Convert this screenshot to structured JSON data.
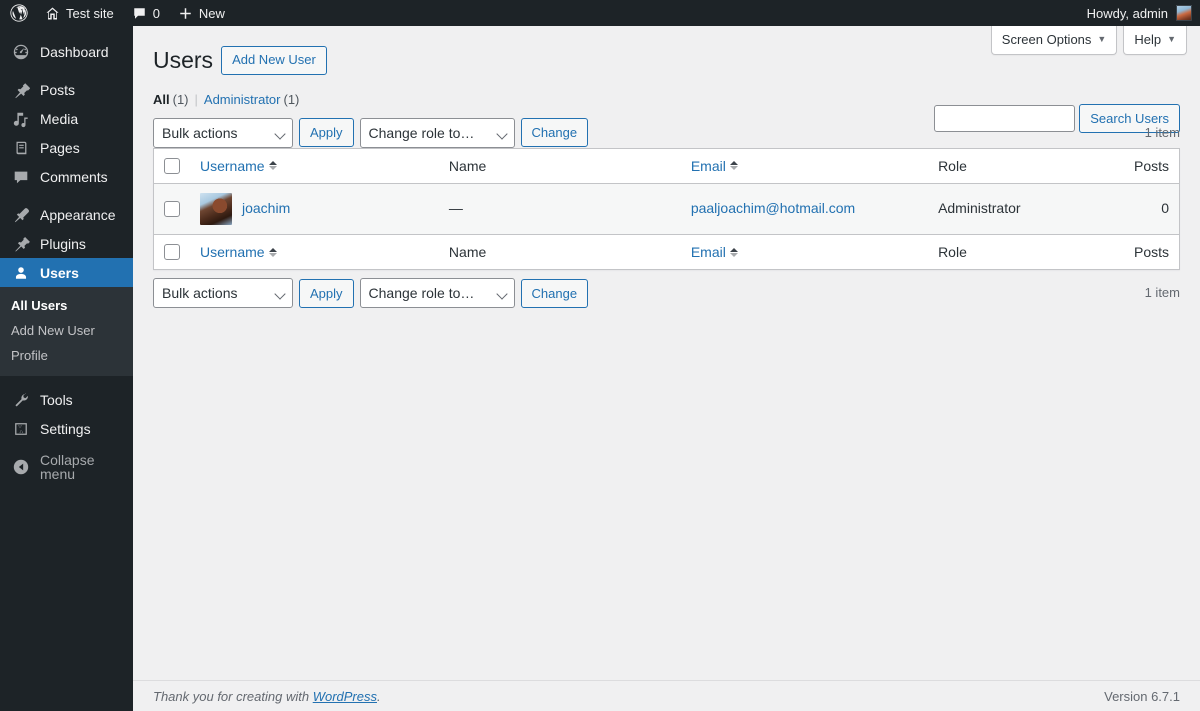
{
  "adminbar": {
    "site_name": "Test site",
    "comments_count": "0",
    "new_label": "New",
    "howdy": "Howdy, admin"
  },
  "sidebar": {
    "items": [
      {
        "label": "Dashboard",
        "icon": "dashboard-icon",
        "current": false
      },
      {
        "label": "Posts",
        "icon": "posts-pin-icon",
        "current": false
      },
      {
        "label": "Media",
        "icon": "media-icon",
        "current": false
      },
      {
        "label": "Pages",
        "icon": "pages-icon",
        "current": false
      },
      {
        "label": "Comments",
        "icon": "comments-icon",
        "current": false
      },
      {
        "label": "Appearance",
        "icon": "appearance-brush-icon",
        "current": false
      },
      {
        "label": "Plugins",
        "icon": "plugins-plug-icon",
        "current": false
      },
      {
        "label": "Users",
        "icon": "users-icon",
        "current": true
      },
      {
        "label": "Tools",
        "icon": "tools-wrench-icon",
        "current": false
      },
      {
        "label": "Settings",
        "icon": "settings-sliders-icon",
        "current": false
      }
    ],
    "submenu": [
      {
        "label": "All Users",
        "current": true
      },
      {
        "label": "Add New User",
        "current": false
      },
      {
        "label": "Profile",
        "current": false
      }
    ],
    "collapse_label": "Collapse menu"
  },
  "screen_meta": {
    "screen_options": "Screen Options",
    "help": "Help",
    "caret": "▼"
  },
  "page": {
    "title": "Users",
    "add_new_button": "Add New User"
  },
  "filters": [
    {
      "label": "All",
      "count": "(1)",
      "current": true
    },
    {
      "label": "Administrator",
      "count": "(1)",
      "current": false
    }
  ],
  "filter_divider": "|",
  "search": {
    "value": "",
    "placeholder": "",
    "button_label": "Search Users"
  },
  "tablenav": {
    "bulk_actions_selected": "Bulk actions",
    "apply_label": "Apply",
    "change_role_selected": "Change role to…",
    "change_label": "Change",
    "displaying_num": "1 item"
  },
  "table": {
    "columns": [
      {
        "key": "cb",
        "label": "",
        "sortable": false
      },
      {
        "key": "username",
        "label": "Username",
        "sortable": true
      },
      {
        "key": "name",
        "label": "Name",
        "sortable": false
      },
      {
        "key": "email",
        "label": "Email",
        "sortable": true
      },
      {
        "key": "role",
        "label": "Role",
        "sortable": false
      },
      {
        "key": "posts",
        "label": "Posts",
        "sortable": false
      }
    ],
    "rows": [
      {
        "username": "joachim",
        "name": "—",
        "email": "paaljoachim@hotmail.com",
        "role": "Administrator",
        "posts": "0"
      }
    ]
  },
  "footer": {
    "thanks_prefix": "Thank you for creating with ",
    "wordpress_link": "WordPress",
    "thanks_suffix": ".",
    "version": "Version 6.7.1"
  },
  "colors": {
    "admin_blue": "#2271b1",
    "sidebar_bg": "#1d2327",
    "submenu_bg": "#2c3338",
    "content_bg": "#f0f0f1",
    "row_bg": "#f6f7f7",
    "border": "#c3c4c7"
  }
}
